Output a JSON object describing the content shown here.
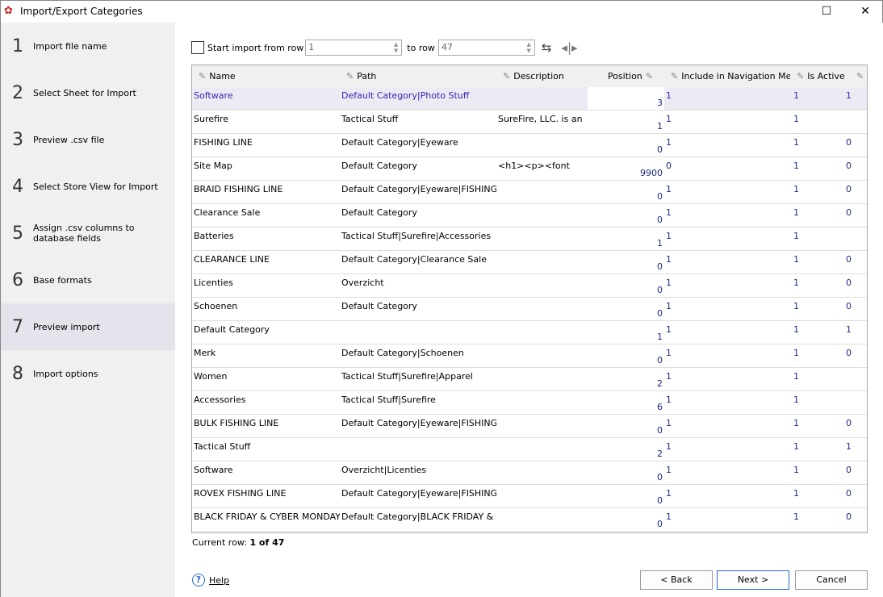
{
  "window": {
    "title": "Import/Export Categories"
  },
  "steps": [
    {
      "num": "1",
      "label": "Import file name"
    },
    {
      "num": "2",
      "label": "Select Sheet for Import"
    },
    {
      "num": "3",
      "label": "Preview .csv file"
    },
    {
      "num": "4",
      "label": "Select Store View for Import"
    },
    {
      "num": "5",
      "label": "Assign .csv columns to database fields"
    },
    {
      "num": "6",
      "label": "Base formats"
    },
    {
      "num": "7",
      "label": "Preview import"
    },
    {
      "num": "8",
      "label": "Import options"
    }
  ],
  "active_step": 7,
  "toolbar": {
    "start_label": "Start import from row",
    "from_value": "1",
    "to_label": "to row",
    "to_value": "47"
  },
  "columns": [
    "Name",
    "Path",
    "Description",
    "Position",
    "Include in Navigation Me",
    "Is Active",
    ""
  ],
  "rows": [
    [
      "Software",
      "Default Category|Photo Stuff",
      "",
      "3",
      "1",
      "1",
      "1"
    ],
    [
      "Surefire",
      "Tactical Stuff",
      "SureFire, LLC. is an",
      "1",
      "1",
      "1",
      ""
    ],
    [
      "FISHING LINE",
      "Default Category|Eyeware",
      "",
      "0",
      "1",
      "1",
      "0"
    ],
    [
      "Site Map",
      "Default Category",
      "<h1><p><font",
      "9900",
      "0",
      "1",
      "0"
    ],
    [
      "BRAID FISHING LINE",
      "Default Category|Eyeware|FISHING",
      "",
      "0",
      "1",
      "1",
      "0"
    ],
    [
      "Clearance Sale",
      "Default Category",
      "",
      "0",
      "1",
      "1",
      "0"
    ],
    [
      "Batteries",
      "Tactical Stuff|Surefire|Accessories",
      "",
      "1",
      "1",
      "1",
      ""
    ],
    [
      "CLEARANCE LINE",
      "Default Category|Clearance Sale",
      "",
      "0",
      "1",
      "1",
      "0"
    ],
    [
      "Licenties",
      "Overzicht",
      "",
      "0",
      "1",
      "1",
      "0"
    ],
    [
      "Schoenen",
      "Default Category",
      "",
      "0",
      "1",
      "1",
      "0"
    ],
    [
      "Default Category",
      "",
      "",
      "1",
      "1",
      "1",
      "1"
    ],
    [
      "Merk",
      "Default Category|Schoenen",
      "",
      "0",
      "1",
      "1",
      "0"
    ],
    [
      "Women",
      "Tactical Stuff|Surefire|Apparel",
      "",
      "2",
      "1",
      "1",
      ""
    ],
    [
      "Accessories",
      "Tactical Stuff|Surefire",
      "",
      "6",
      "1",
      "1",
      ""
    ],
    [
      "BULK FISHING LINE",
      "Default Category|Eyeware|FISHING",
      "",
      "0",
      "1",
      "1",
      "0"
    ],
    [
      "Tactical Stuff",
      "",
      "",
      "2",
      "1",
      "1",
      "1"
    ],
    [
      "Software",
      "Overzicht|Licenties",
      "",
      "0",
      "1",
      "1",
      "0"
    ],
    [
      "ROVEX FISHING LINE",
      "Default Category|Eyeware|FISHING",
      "",
      "0",
      "1",
      "1",
      "0"
    ],
    [
      "BLACK FRIDAY & CYBER MONDAY",
      "Default Category|BLACK FRIDAY &",
      "",
      "0",
      "1",
      "1",
      "0"
    ]
  ],
  "status": {
    "label": "Current row:",
    "value": "1 of 47"
  },
  "footer": {
    "help": "Help",
    "back": "< Back",
    "next": "Next >",
    "cancel": "Cancel"
  }
}
